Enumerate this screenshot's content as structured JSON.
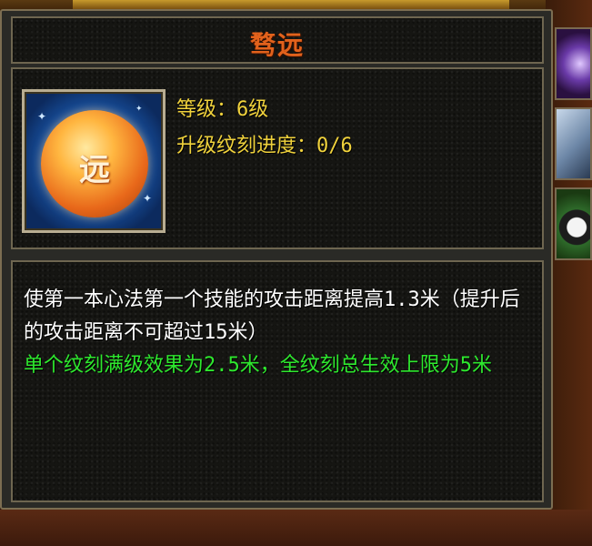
{
  "panel": {
    "title": "骛远"
  },
  "skill": {
    "icon": "coin-glyph-icon",
    "icon_glyph": "远",
    "level_text": "等级：6级",
    "progress_text": "升级纹刻进度：0/6"
  },
  "description": {
    "main": "使第一本心法第一个技能的攻击距离提高1.3米（提升后的攻击距离不可超过15米）",
    "bonus": "单个纹刻满级效果为2.5米，全纹刻总生效上限为5米"
  },
  "colors": {
    "title": "#e2621c",
    "info_text": "#f0d23c",
    "description_text": "#ffffff",
    "bonus_text": "#2ee82e",
    "frame_border": "#6e6650"
  }
}
